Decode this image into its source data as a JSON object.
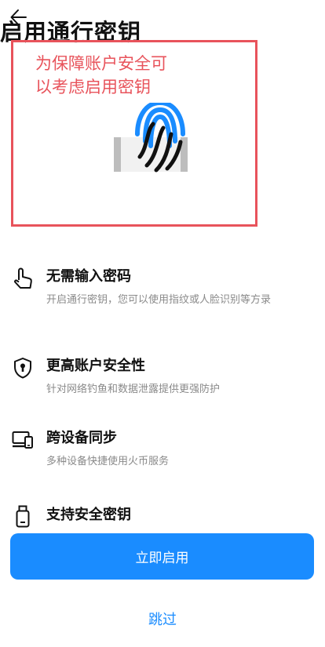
{
  "header": {
    "back_icon": "arrow-left-icon"
  },
  "hero": {
    "title": "启用通行密钥",
    "annotation": "为保障账户安全可以考虑启用密钥",
    "illustration_icon": "fingerprint-icon",
    "accent_color": "#1a8cff",
    "annotation_color": "#e8535b"
  },
  "features": [
    {
      "icon": "hand-pointer-icon",
      "title": "无需输入密码",
      "desc": "开启通行密钥，您可以使用指纹或人脸识别等方录"
    },
    {
      "icon": "shield-keyhole-icon",
      "title": "更高账户安全性",
      "desc": "针对网络钓鱼和数据泄露提供更强防护"
    },
    {
      "icon": "devices-icon",
      "title": "跨设备同步",
      "desc": "多种设备快捷使用火币服务"
    },
    {
      "icon": "security-key-icon",
      "title": "支持安全密钥",
      "desc": ""
    }
  ],
  "actions": {
    "primary_label": "立即启用",
    "skip_label": "跳过"
  }
}
